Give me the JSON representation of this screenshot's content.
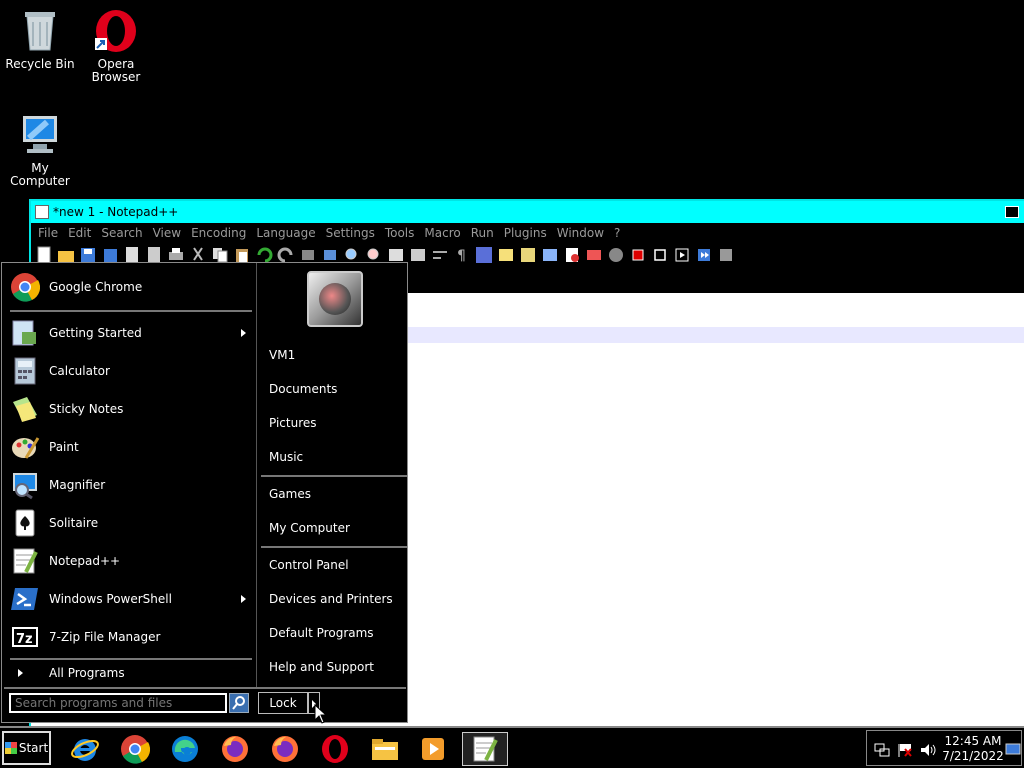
{
  "desktop": {
    "icons": [
      {
        "label": "Recycle Bin"
      },
      {
        "label": "Opera Browser"
      },
      {
        "label": "My Computer"
      }
    ]
  },
  "notepad": {
    "title": "*new 1 - Notepad++",
    "menu": [
      "File",
      "Edit",
      "Search",
      "View",
      "Encoding",
      "Language",
      "Settings",
      "Tools",
      "Macro",
      "Run",
      "Plugins",
      "Window",
      "?"
    ]
  },
  "start_menu": {
    "programs": [
      {
        "label": "Google Chrome",
        "icon": "chrome-icon",
        "submenu": false
      },
      {
        "label": "Getting Started",
        "icon": "getting-started-icon",
        "submenu": true
      },
      {
        "label": "Calculator",
        "icon": "calculator-icon",
        "submenu": false
      },
      {
        "label": "Sticky Notes",
        "icon": "sticky-notes-icon",
        "submenu": false
      },
      {
        "label": "Paint",
        "icon": "paint-icon",
        "submenu": false
      },
      {
        "label": "Magnifier",
        "icon": "magnifier-icon",
        "submenu": false
      },
      {
        "label": "Solitaire",
        "icon": "solitaire-icon",
        "submenu": false
      },
      {
        "label": "Notepad++",
        "icon": "notepadpp-icon",
        "submenu": false
      },
      {
        "label": "Windows PowerShell",
        "icon": "powershell-icon",
        "submenu": true
      },
      {
        "label": "7-Zip File Manager",
        "icon": "7zip-icon",
        "submenu": false
      }
    ],
    "all_programs": "All Programs",
    "search_placeholder": "Search programs and files",
    "right": {
      "user": "VM1",
      "documents": "Documents",
      "pictures": "Pictures",
      "music": "Music",
      "games": "Games",
      "my_computer": "My Computer",
      "control_panel": "Control Panel",
      "devices": "Devices and Printers",
      "default_programs": "Default Programs",
      "help": "Help and Support"
    },
    "lock_label": "Lock"
  },
  "taskbar": {
    "start_label": "Start",
    "time": "12:45 AM",
    "date": "7/21/2022"
  }
}
